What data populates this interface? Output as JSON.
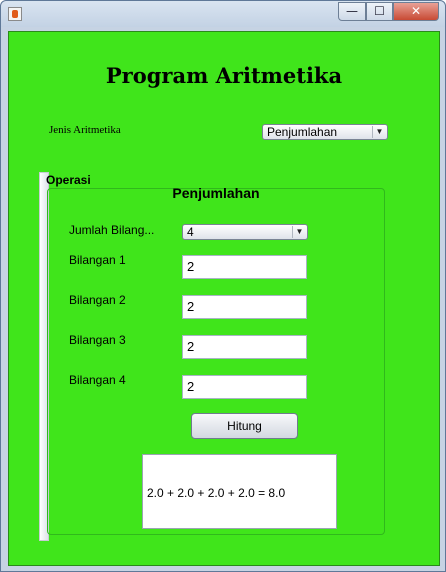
{
  "window": {
    "title": "",
    "min_label": "—",
    "max_label": "☐",
    "close_label": "✕"
  },
  "main": {
    "heading": "Program Aritmetika",
    "jenis_label": "Jenis Aritmetika",
    "jenis_value": "Penjumlahan"
  },
  "operasi": {
    "label": "Operasi",
    "group_title": "Penjumlahan",
    "jumlah_label": "Jumlah Bilang...",
    "jumlah_value": "4",
    "fields": [
      {
        "label": "Bilangan 1",
        "value": "2"
      },
      {
        "label": "Bilangan 2",
        "value": "2"
      },
      {
        "label": "Bilangan 3",
        "value": "2"
      },
      {
        "label": "Bilangan 4",
        "value": "2"
      }
    ],
    "button_label": "Hitung",
    "result": "2.0 + 2.0 + 2.0 + 2.0 = 8.0"
  },
  "colors": {
    "background": "#40e51b"
  }
}
